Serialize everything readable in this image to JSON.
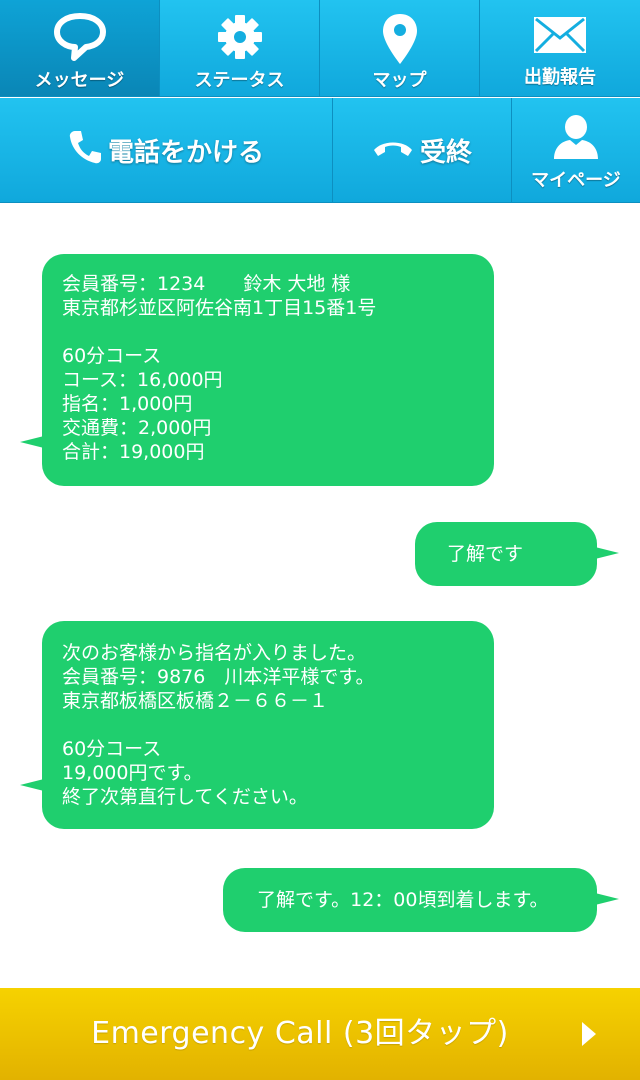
{
  "nav": {
    "message": {
      "label": "メッセージ",
      "icon": "speech-bubble-icon"
    },
    "status": {
      "label": "ステータス",
      "icon": "gear-icon"
    },
    "map": {
      "label": "マップ",
      "icon": "map-pin-icon"
    },
    "report": {
      "label": "出勤報告",
      "icon": "envelope-icon"
    },
    "call": {
      "label": "電話をかける",
      "icon": "phone-icon"
    },
    "hangup": {
      "label": "受終",
      "icon": "hang-up-phone-icon"
    },
    "mypage": {
      "label": "マイページ",
      "icon": "person-icon"
    }
  },
  "messages": [
    {
      "side": "received",
      "text": "会員番号：1234　　鈴木 大地 様\n東京都杉並区阿佐谷南1丁目15番1号\n\n60分コース\nコース：16,000円\n指名：1,000円\n交通費：2,000円\n合計：19,000円"
    },
    {
      "side": "sent",
      "text": "了解です"
    },
    {
      "side": "received",
      "text": "次のお客様から指名が入りました。\n会員番号：9876　川本洋平様です。\n東京都板橋区板橋２－６６－１\n\n60分コース\n19,000円です。\n終了次第直行してください。"
    },
    {
      "side": "sent",
      "text": "了解です。12：00頃到着します。"
    }
  ],
  "emergency": {
    "label": "Emergency Call (3回タップ)",
    "icon": "play-arrow-icon"
  },
  "colors": {
    "nav_blue": "#18b4e6",
    "nav_active": "#0ea3d6",
    "bubble_green": "#1fcf6e",
    "emergency_yellow": "#f0c800"
  }
}
